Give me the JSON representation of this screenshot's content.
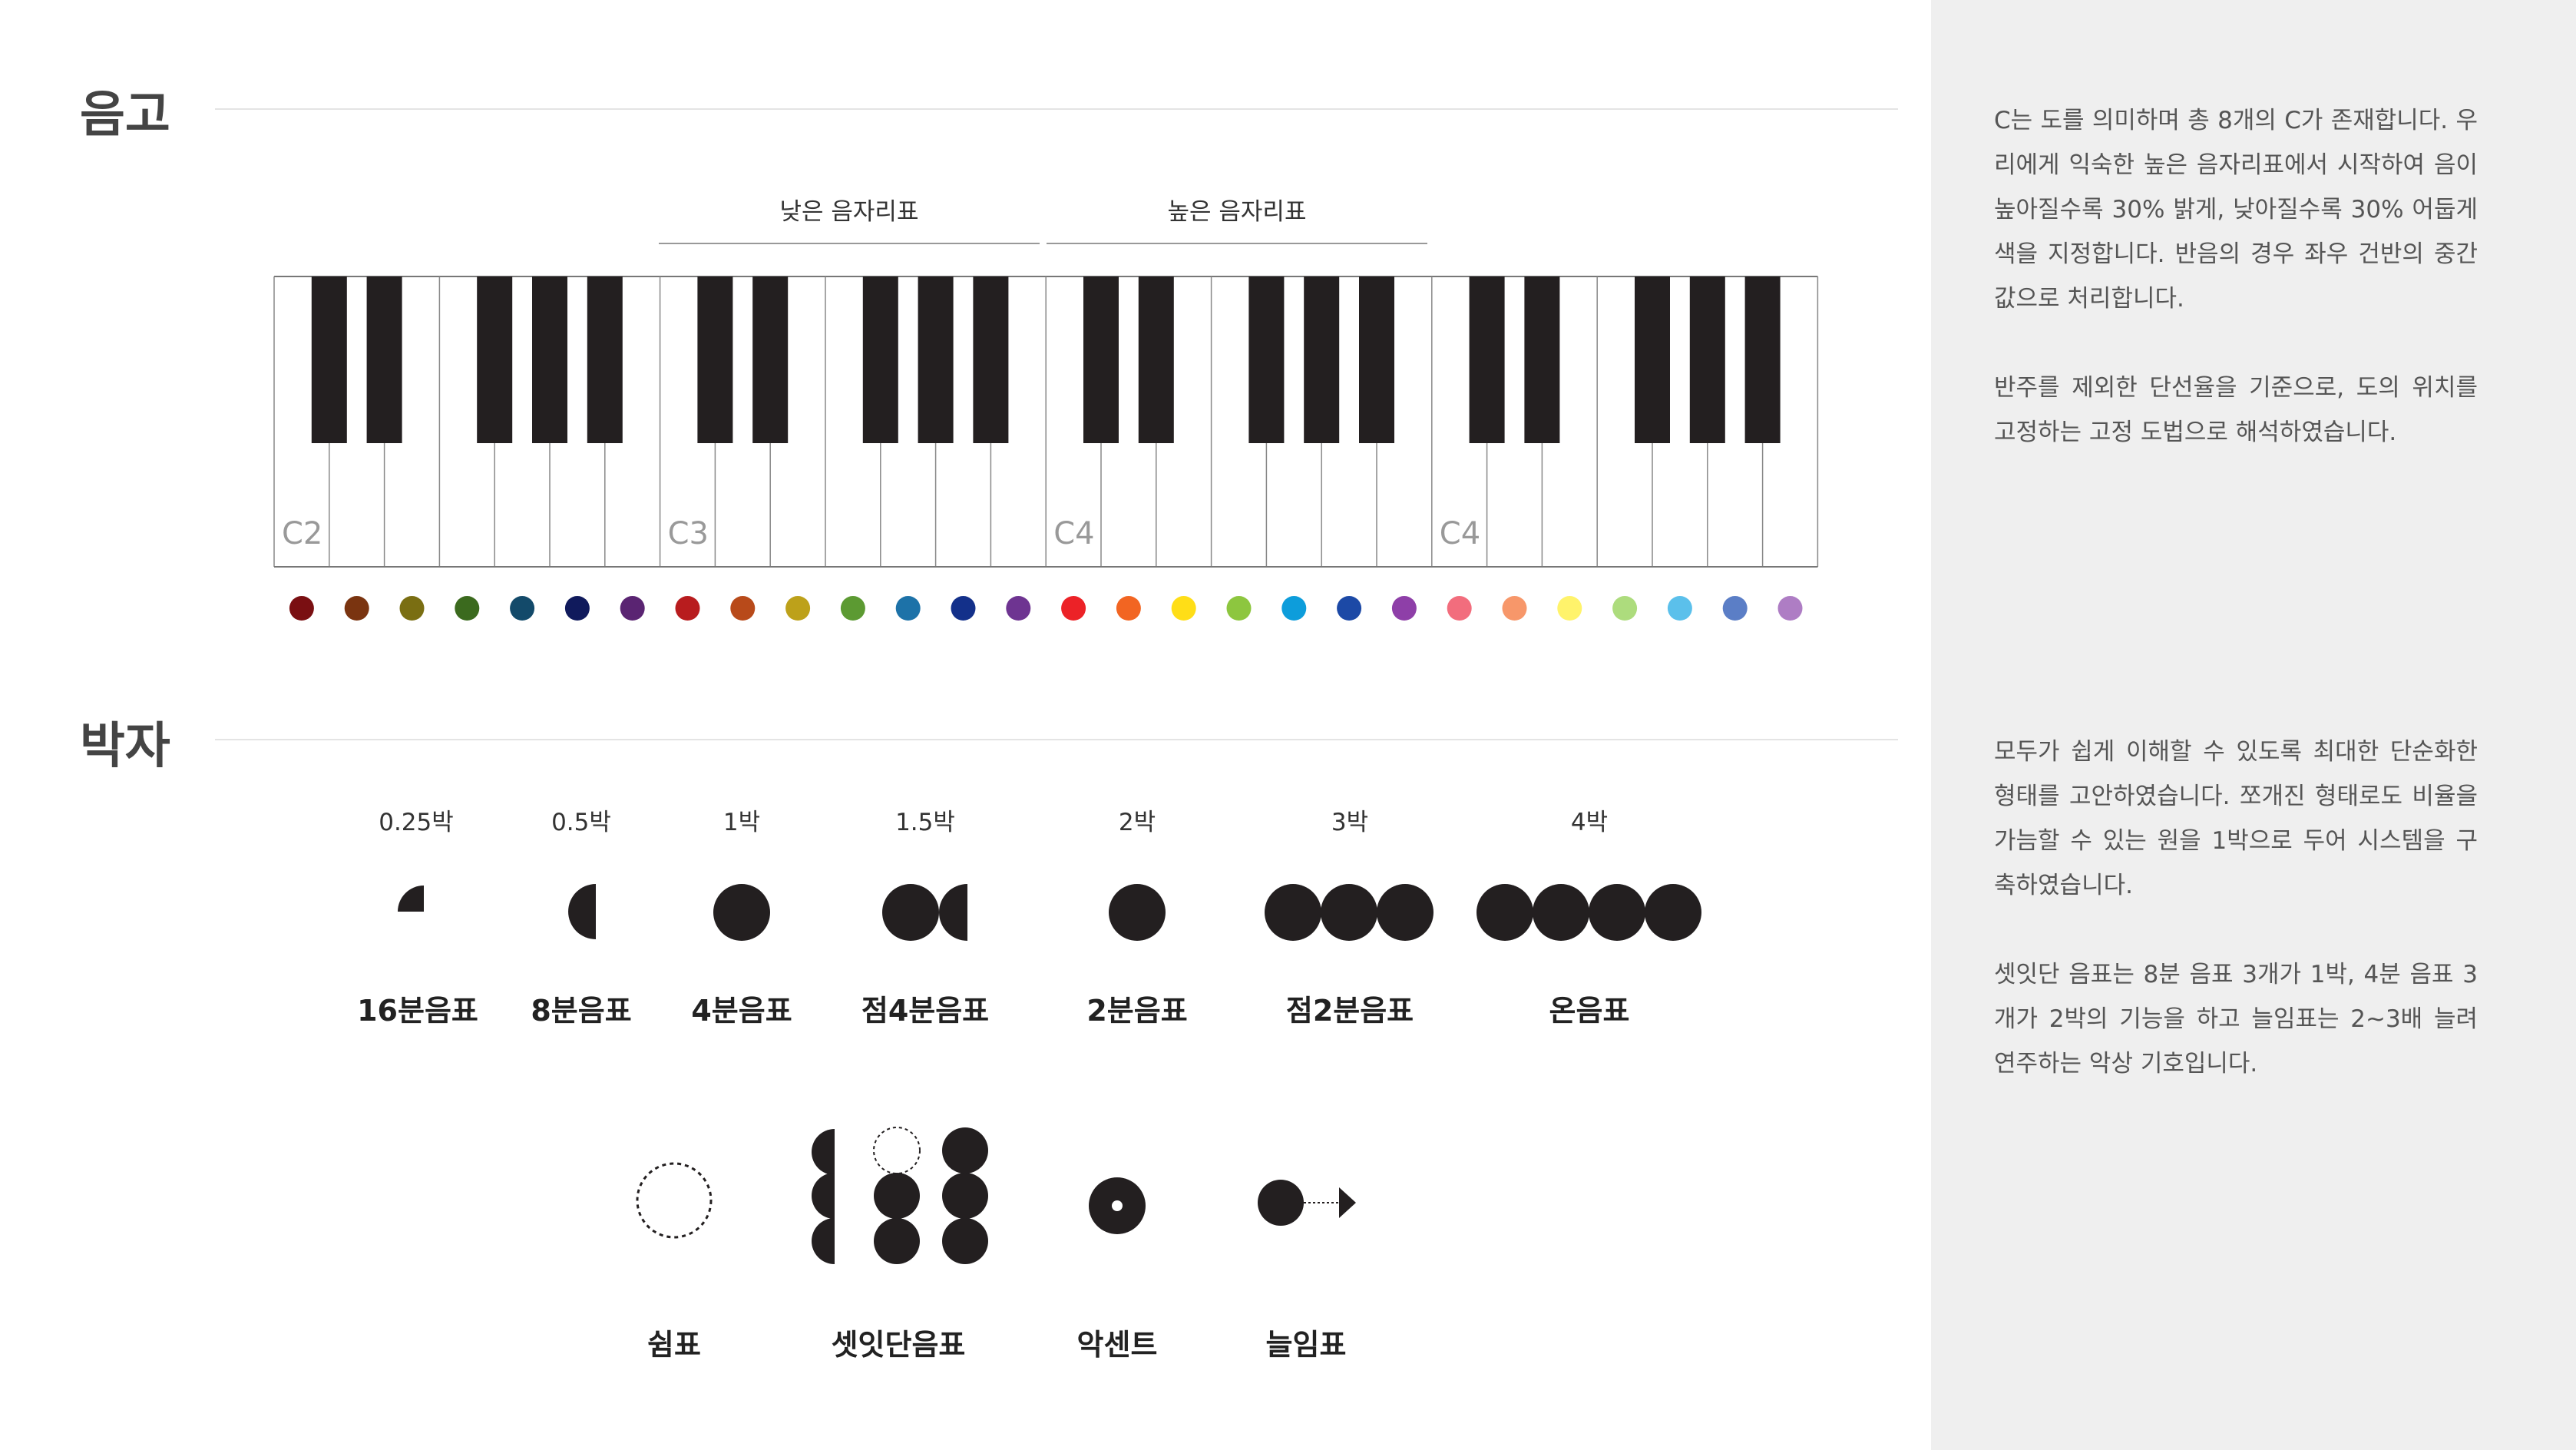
{
  "pitch": {
    "title": "음고",
    "low_range_label": "낮은 음자리표",
    "high_range_label": "높은 음자리표",
    "octave_labels": [
      "C2",
      "C3",
      "C4",
      "C4"
    ],
    "key_colors": [
      "#7a0f12",
      "#7a3410",
      "#7a6e12",
      "#3b6a1e",
      "#134a6a",
      "#101a5c",
      "#5a2472",
      "#b81c1e",
      "#b84a1a",
      "#bda11a",
      "#5c9a32",
      "#1d72a8",
      "#13308a",
      "#6e3491",
      "#ec2227",
      "#f26522",
      "#ffde17",
      "#8dc63f",
      "#0d9ddb",
      "#1c49a6",
      "#8e3fa8",
      "#f26d7d",
      "#f7976a",
      "#fff36b",
      "#addc7d",
      "#5bc0eb",
      "#5b7ec6",
      "#ae7dc4"
    ]
  },
  "rhythm": {
    "title": "박자",
    "notes": [
      {
        "beat": "0.25박",
        "name": "16분음표"
      },
      {
        "beat": "0.5박",
        "name": "8분음표"
      },
      {
        "beat": "1박",
        "name": "4분음표"
      },
      {
        "beat": "1.5박",
        "name": "점4분음표"
      },
      {
        "beat": "2박",
        "name": "2분음표"
      },
      {
        "beat": "3박",
        "name": "점2분음표"
      },
      {
        "beat": "4박",
        "name": "온음표"
      }
    ],
    "symbols": [
      {
        "name": "쉼표"
      },
      {
        "name": "셋잇단음표"
      },
      {
        "name": "악센트"
      },
      {
        "name": "늘임표"
      }
    ]
  },
  "sidebar": {
    "pitch_text": "C는 도를 의미하며 총 8개의 C가 존재합니다. 우리에게 익숙한 높은 음자리표에서 시작하여 음이 높아질수록 30% 밝게, 낮아질수록 30% 어둡게 색을 지정합니다. 반음의 경우 좌우 건반의 중간 값으로 처리합니다.\n\n반주를 제외한 단선율을 기준으로, 도의 위치를 고정하는 고정 도법으로 해석하였습니다.",
    "rhythm_text": "모두가 쉽게 이해할 수 있도록 최대한 단순화한 형태를 고안하였습니다. 쪼개진 형태로도 비율을 가늠할 수 있는 원을 1박으로 두어 시스템을 구축하였습니다.\n\n셋잇단 음표는 8분 음표 3개가 1박, 4분 음표 3개가 2박의 기능을 하고 늘임표는 2~3배 늘려 연주하는 악상 기호입니다."
  }
}
